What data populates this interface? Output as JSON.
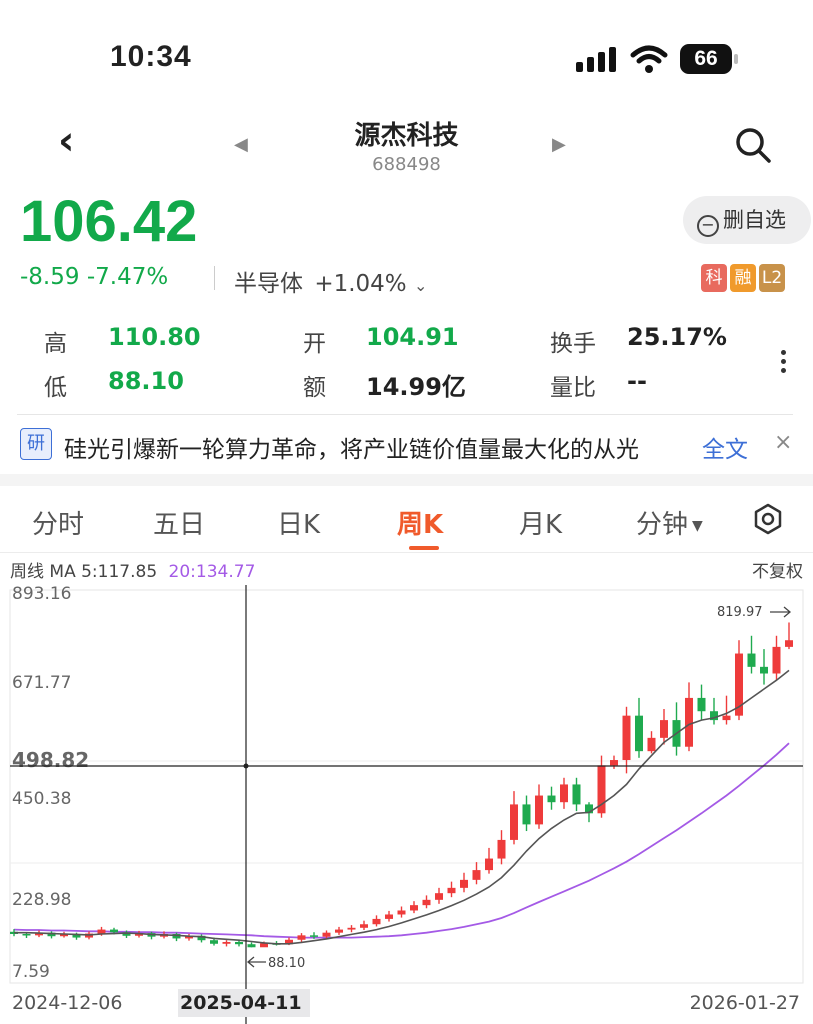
{
  "status_bar": {
    "time": "10:34",
    "battery": "66"
  },
  "header": {
    "title": "源杰科技",
    "code": "688498"
  },
  "quote": {
    "price": "106.42",
    "change": "-8.59 -7.47%",
    "sector": "半导体",
    "sector_change": "+1.04%",
    "watch_button": "删自选",
    "badges": [
      {
        "label": "科",
        "color": "#e86a5e"
      },
      {
        "label": "融",
        "color": "#f09a2c"
      },
      {
        "label": "L2",
        "color": "#c8924a"
      }
    ]
  },
  "stats": {
    "high_label": "高",
    "high": "110.80",
    "low_label": "低",
    "low": "88.10",
    "open_label": "开",
    "open": "104.91",
    "amount_label": "额",
    "amount": "14.99亿",
    "turnover_label": "换手",
    "turnover": "25.17%",
    "volratio_label": "量比",
    "volratio": "--"
  },
  "news": {
    "tag": "研",
    "text": "硅光引爆新一轮算力革命，将产业链价值量最大化的从光",
    "full": "全文",
    "close": "×"
  },
  "tabs": [
    {
      "label": "分时"
    },
    {
      "label": "五日"
    },
    {
      "label": "日K"
    },
    {
      "label": "周K"
    },
    {
      "label": "月K"
    },
    {
      "label": "分钟"
    }
  ],
  "active_tab": "周K",
  "ma": {
    "prefix": "周线 MA 5:117.85",
    "ma20": "20:134.77",
    "adjust": "不复权"
  },
  "colors": {
    "up": "#ee3b3b",
    "down": "#1faa4f",
    "ma5": "#555555",
    "ma20": "#a45ae6",
    "price_green": "#12a94a",
    "accent": "#f05a2b"
  },
  "chart_data": {
    "type": "candlestick",
    "y_labels": [
      "893.16",
      "671.77",
      "498.82",
      "450.38",
      "228.98",
      "7.59"
    ],
    "crosshair_value": "498.82",
    "max_label": "819.97",
    "min_label": "88.10",
    "x_labels": {
      "start": "2024-12-06",
      "crosshair": "2025-04-11",
      "end": "2026-01-27"
    },
    "ylim": [
      7.59,
      893.16
    ],
    "candles": [
      [
        123,
        118,
        129,
        113
      ],
      [
        118,
        115,
        122,
        109
      ],
      [
        115,
        121,
        126,
        111
      ],
      [
        121,
        113,
        124,
        108
      ],
      [
        113,
        118,
        123,
        110
      ],
      [
        118,
        110,
        121,
        105
      ],
      [
        110,
        119,
        124,
        106
      ],
      [
        119,
        128,
        134,
        114
      ],
      [
        128,
        122,
        132,
        117
      ],
      [
        122,
        114,
        126,
        109
      ],
      [
        114,
        120,
        125,
        110
      ],
      [
        120,
        112,
        123,
        106
      ],
      [
        112,
        118,
        124,
        108
      ],
      [
        118,
        108,
        121,
        102
      ],
      [
        108,
        114,
        118,
        103
      ],
      [
        114,
        104,
        117,
        99
      ],
      [
        104,
        96,
        110,
        92
      ],
      [
        96,
        100,
        104,
        90
      ],
      [
        100,
        95,
        104,
        90
      ],
      [
        95,
        88.1,
        99,
        88.1
      ],
      [
        88.1,
        97,
        101,
        90
      ],
      [
        97,
        95,
        102,
        92
      ],
      [
        95,
        105,
        110,
        93
      ],
      [
        105,
        115,
        120,
        100
      ],
      [
        115,
        112,
        122,
        107
      ],
      [
        112,
        121,
        126,
        108
      ],
      [
        121,
        128,
        134,
        116
      ],
      [
        128,
        132,
        138,
        122
      ],
      [
        132,
        140,
        148,
        127
      ],
      [
        140,
        152,
        160,
        135
      ],
      [
        152,
        162,
        170,
        146
      ],
      [
        162,
        171,
        180,
        155
      ],
      [
        171,
        183,
        192,
        165
      ],
      [
        183,
        195,
        205,
        176
      ],
      [
        195,
        210,
        222,
        186
      ],
      [
        210,
        222,
        236,
        201
      ],
      [
        222,
        240,
        256,
        212
      ],
      [
        240,
        262,
        280,
        230
      ],
      [
        262,
        288,
        312,
        254
      ],
      [
        288,
        330,
        352,
        275
      ],
      [
        330,
        410,
        440,
        320
      ],
      [
        410,
        365,
        430,
        350
      ],
      [
        365,
        430,
        455,
        355
      ],
      [
        430,
        415,
        450,
        398
      ],
      [
        415,
        455,
        470,
        400
      ],
      [
        455,
        410,
        470,
        395
      ],
      [
        410,
        390,
        415,
        370
      ],
      [
        390,
        498,
        520,
        380
      ],
      [
        498,
        510,
        520,
        490
      ],
      [
        510,
        610,
        630,
        480
      ],
      [
        610,
        530,
        650,
        515
      ],
      [
        530,
        560,
        575,
        525
      ],
      [
        560,
        600,
        625,
        545
      ],
      [
        600,
        540,
        640,
        520
      ],
      [
        540,
        650,
        685,
        530
      ],
      [
        650,
        620,
        680,
        600
      ],
      [
        620,
        600,
        650,
        590
      ],
      [
        600,
        610,
        655,
        590
      ],
      [
        610,
        750,
        780,
        600
      ],
      [
        750,
        720,
        790,
        705
      ],
      [
        720,
        705,
        760,
        680
      ],
      [
        705,
        765,
        790,
        690
      ],
      [
        765,
        780,
        820,
        760
      ]
    ],
    "ma5": [
      121,
      121,
      120,
      119,
      118,
      117,
      116,
      118,
      119,
      120,
      119,
      117,
      116,
      115,
      113,
      112,
      108,
      106,
      104,
      101,
      98,
      96,
      96,
      99,
      103,
      107,
      112,
      117,
      122,
      128,
      135,
      143,
      152,
      161,
      171,
      182,
      194,
      208,
      224,
      245,
      273,
      305,
      333,
      356,
      375,
      390,
      392,
      410,
      430,
      455,
      490,
      520,
      550,
      570,
      590,
      600,
      605,
      615,
      630,
      650,
      670,
      690,
      712
    ],
    "ma20": [
      128,
      127,
      127,
      126,
      126,
      125,
      124,
      124,
      123,
      123,
      122,
      122,
      121,
      121,
      120,
      119,
      118,
      117,
      116,
      115,
      113,
      112,
      111,
      110,
      110,
      110,
      110,
      110,
      111,
      112,
      113,
      115,
      118,
      121,
      125,
      129,
      134,
      140,
      146,
      154,
      165,
      178,
      190,
      202,
      214,
      226,
      238,
      252,
      266,
      281,
      298,
      316,
      334,
      352,
      371,
      390,
      410,
      430,
      452,
      475,
      498,
      522,
      548
    ]
  }
}
